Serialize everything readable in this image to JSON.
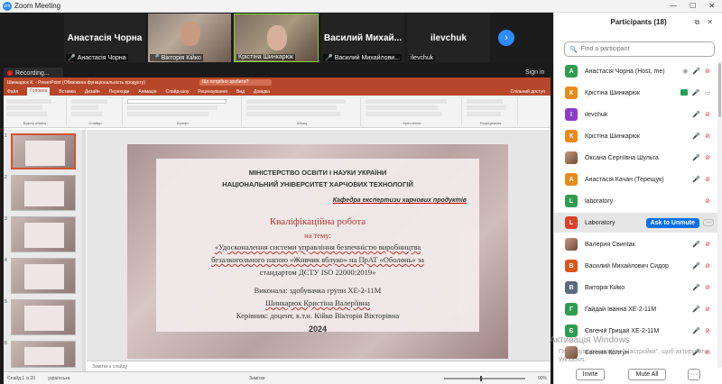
{
  "window": {
    "title": "Zoom Meeting",
    "controls": [
      "—",
      "☐",
      "✕"
    ]
  },
  "video_strip": {
    "tiles": [
      {
        "display_name": "Анастасія Чорна",
        "label": "Анастасія Чорна",
        "type": "name"
      },
      {
        "display_name": "",
        "label": "Вікторія Кійко",
        "type": "video"
      },
      {
        "display_name": "",
        "label": "Крістіна Шинкарюк",
        "type": "video-active"
      },
      {
        "display_name": "Василий  Михай...",
        "label": "Василий Михайлови...",
        "type": "name"
      },
      {
        "display_name": "ilevchuk",
        "label": "ilevchuk",
        "type": "name"
      }
    ],
    "next_icon": "›"
  },
  "recording": {
    "label": "Recording..."
  },
  "sign_in": "Sign in",
  "powerpoint": {
    "title": "Шинкарюк К. - PowerPoint (Обмежена функціональність продукту)",
    "search_placeholder": "Що потрібно зробити?",
    "tabs": [
      "Файл",
      "Головна",
      "Вставка",
      "Дизайн",
      "Переходи",
      "Анімація",
      "Слайд-шоу",
      "Рецензування",
      "Вид",
      "Довідка"
    ],
    "share_label": "Спільний доступ",
    "ribbon_groups": [
      "Буфер обміну",
      "Слайди",
      "Шрифт",
      "Абзац",
      "Креслення",
      "Редагування"
    ],
    "slide_numbers": [
      "1",
      "2",
      "3",
      "4",
      "5",
      "6"
    ],
    "slide": {
      "ministry": "МІНІСТЕРСТВО ОСВІТИ І НАУКИ УКРАЇНИ",
      "university": "НАЦІОНАЛЬНИЙ  УНІВЕРСИТЕТ ХАРЧОВИХ ТЕХНОЛОГІЙ",
      "department": "Кафедра експертизи харчових продуктів",
      "work_title": "Кваліфікаційна робота",
      "on_topic": "на тему:",
      "topic_line1": "«Удосконалення системи управління безпечністю виробництва",
      "topic_line2": "безалкогольного напою «Живчик яблуко» на ПрАТ «Оболонь» за",
      "topic_line3": "стандартом ДСТУ ISO 22000:2019»",
      "performer": "Виконала: здобувачка групи ХЕ-2-11М",
      "student": "Шинкарюк Кристіна Валеріївна",
      "supervisor": "Керівник: доцент, к.т.н. Кійко Вікторія Вікторівна",
      "year": "2024"
    },
    "notes_placeholder": "Замітки к слайду",
    "status_left": "Слайд 1 із 20",
    "status_lang": "українська",
    "status_right": "Замітки",
    "zoom": "90%"
  },
  "participants": {
    "header": "Participants (18)",
    "search_placeholder": "Find a participant",
    "rows": [
      {
        "name": "Анастасія Чорна (Host, me)",
        "initial": "А",
        "color": "#2e9d4f",
        "icons": [
          "share",
          "mic-off",
          "cam-off"
        ]
      },
      {
        "name": "Крістіна Шинкарюк",
        "initial": "К",
        "color": "#e88a1a",
        "icons": [
          "green",
          "mic",
          "cam"
        ]
      },
      {
        "name": "ilevchuk",
        "initial": "I",
        "color": "#8b3cc9",
        "icons": [
          "mic",
          "cam-off"
        ]
      },
      {
        "name": "Крістіна Шинкарюк",
        "initial": "К",
        "color": "#e88a1a",
        "icons": [
          "mic",
          "cam-off"
        ]
      },
      {
        "name": "Оксана Сергіївна Шульга",
        "initial": "",
        "color": "photo",
        "icons": [
          "mic-off",
          "cam-off"
        ]
      },
      {
        "name": "Анастасія Качан (Терещук)",
        "initial": "А",
        "color": "#e88a1a",
        "icons": [
          "mic-off",
          "cam-off"
        ]
      },
      {
        "name": "laboratory",
        "initial": "L",
        "color": "#2e9d4f",
        "icons": [
          "cam-off"
        ]
      },
      {
        "name": "Laboratory",
        "initial": "L",
        "color": "#d9422a",
        "icons": [],
        "highlight": true,
        "action": "Ask to Unmute",
        "more": "···"
      },
      {
        "name": "Валерия Свиntак",
        "initial": "",
        "color": "photo",
        "icons": [
          "mic-off",
          "cam-off"
        ]
      },
      {
        "name": "Василий Михайлович Сидор",
        "initial": "В",
        "color": "#d9561a",
        "icons": [
          "mic-off",
          "cam-off"
        ]
      },
      {
        "name": "Вікторія Кійко",
        "initial": "В",
        "color": "#5b6b7c",
        "icons": [
          "mic-off",
          "cam-off"
        ]
      },
      {
        "name": "Гайдай Іванна ХЕ-2-11М",
        "initial": "Г",
        "color": "#2e9d4f",
        "icons": [
          "mic-off",
          "cam-off"
        ]
      },
      {
        "name": "Євгеній Грицай ХЕ-2-11М",
        "initial": "Є",
        "color": "#2e9d4f",
        "icons": [
          "mic-off",
          "cam-off"
        ]
      },
      {
        "name": "Євгенія Колтун",
        "initial": "",
        "color": "photo",
        "icons": [
          "mic-off",
          "cam-off"
        ]
      }
    ],
    "activation_title": "Активація Windows",
    "activation_text": "Перейдіть до розділу \"Настройки\", щоб активувати Windows.",
    "buttons": {
      "invite": "Invite",
      "mute_all": "Mute All",
      "more": "···"
    }
  }
}
